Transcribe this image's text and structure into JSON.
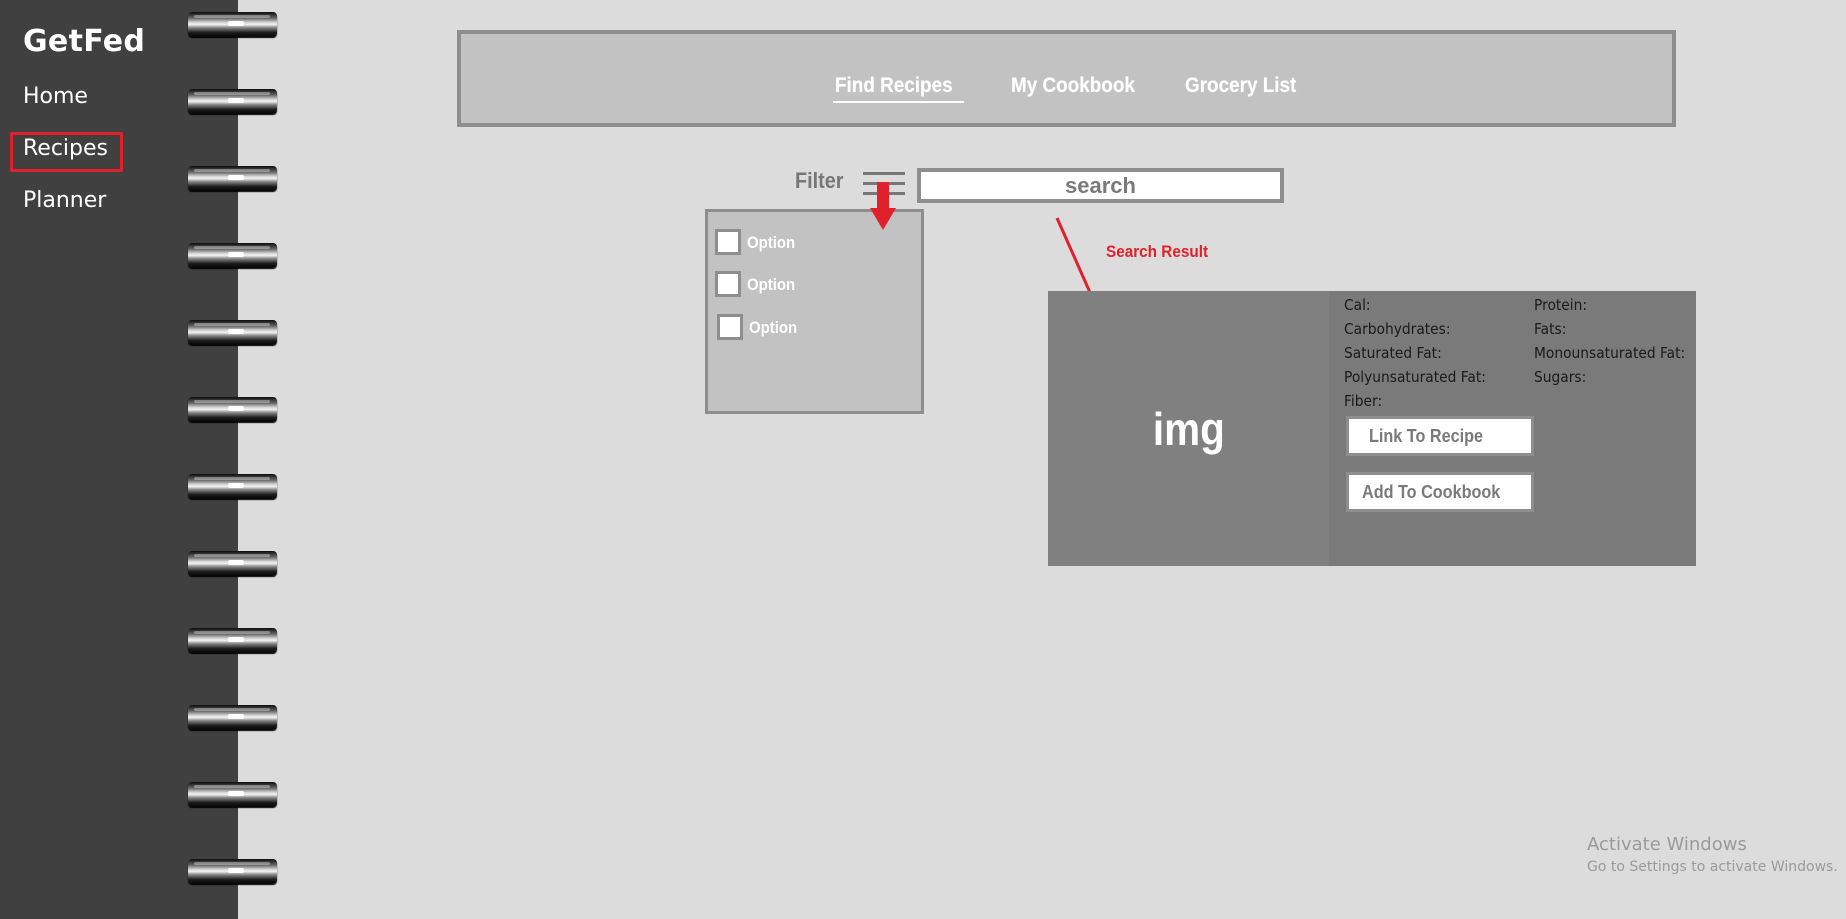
{
  "sidebar": {
    "brand": "GetFed",
    "items": [
      {
        "label": "Home"
      },
      {
        "label": "Recipes",
        "highlighted": true
      },
      {
        "label": "Planner"
      }
    ],
    "background_color": "#404040",
    "highlight_color": "#e0202a",
    "spiral_ring_count": 12
  },
  "topnav": {
    "tabs": [
      {
        "label": "Find Recipes",
        "active": true
      },
      {
        "label": "My Cookbook"
      },
      {
        "label": "Grocery List"
      }
    ]
  },
  "filter": {
    "label": "Filter",
    "icon": "filter-lines-icon",
    "options": [
      {
        "label": "Option",
        "checked": false
      },
      {
        "label": "Option",
        "checked": false
      },
      {
        "label": "Option",
        "checked": false
      }
    ]
  },
  "search": {
    "value": "search"
  },
  "annotation": {
    "label": "Search Result",
    "color": "#e0202a"
  },
  "result": {
    "image_placeholder": "img",
    "nutrition_left": [
      "Cal:",
      "Carbohydrates:",
      "Saturated Fat:",
      "Polyunsaturated Fat:",
      "Fiber:"
    ],
    "nutrition_right": [
      "Protein:",
      "Fats:",
      "Monounsaturated Fat:",
      "Sugars:"
    ],
    "link_button": "Link To Recipe",
    "add_button": "Add To Cookbook"
  },
  "watermark": {
    "title": "Activate Windows",
    "subtitle": "Go to Settings to activate Windows."
  }
}
